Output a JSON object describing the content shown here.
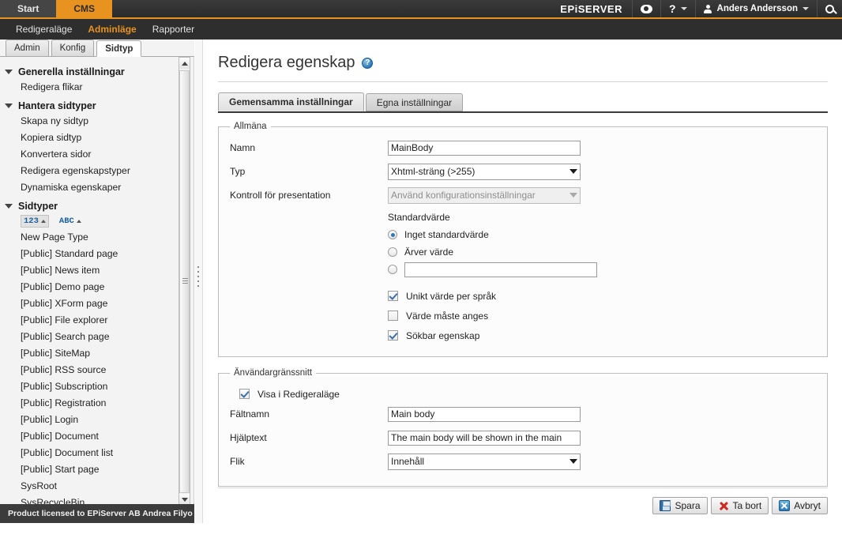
{
  "topbar": {
    "tabs": [
      {
        "label": "Start",
        "active": false
      },
      {
        "label": "CMS",
        "active": true
      }
    ],
    "brand": "EPiSERVER",
    "eye_icon": "eye-icon",
    "help_icon": "?",
    "user_name": "Anders Andersson",
    "search_icon": "search-icon",
    "accent_color": "#e8921f"
  },
  "navbar": {
    "items": [
      {
        "label": "Redigeraläge",
        "active": false
      },
      {
        "label": "Adminläge",
        "active": true
      },
      {
        "label": "Rapporter",
        "active": false
      }
    ]
  },
  "left_panel": {
    "subtabs": [
      {
        "label": "Admin",
        "active": false
      },
      {
        "label": "Konfig",
        "active": false
      },
      {
        "label": "Sidtyp",
        "active": true
      }
    ],
    "groups": [
      {
        "title": "Generella inställningar",
        "items": [
          "Redigera flikar"
        ]
      },
      {
        "title": "Hantera sidtyper",
        "items": [
          "Skapa ny sidtyp",
          "Kopiera sidtyp",
          "Konvertera sidor",
          "Redigera egenskapstyper",
          "Dynamiska egenskaper"
        ]
      },
      {
        "title": "Sidtyper",
        "items": [
          "New Page Type",
          "[Public] Standard page",
          "[Public] News item",
          "[Public] Demo page",
          "[Public] XForm page",
          "[Public] File explorer",
          "[Public] Search page",
          "[Public] SiteMap",
          "[Public] RSS source",
          "[Public] Subscription",
          "[Public] Registration",
          "[Public] Login",
          "[Public] Document",
          "[Public] Document list",
          "[Public] Start page",
          "SysRoot",
          "SysRecycleBin"
        ]
      }
    ],
    "sort_numeric_label": "123",
    "sort_alpha_label": "ABC",
    "license_text": "Product licensed to EPiServer AB Andrea Filyo"
  },
  "main": {
    "page_title": "Redigera egenskap",
    "help_icon_label": "?",
    "tabs": [
      {
        "label": "Gemensamma inställningar",
        "active": true
      },
      {
        "label": "Egna inställningar",
        "active": false
      }
    ],
    "general": {
      "legend": "Allmäna",
      "name_label": "Namn",
      "name_value": "MainBody",
      "type_label": "Typ",
      "type_value": "Xhtml-sträng (>255)",
      "presentation_label": "Kontroll för presentation",
      "presentation_value": "Använd konfigurationsinställningar",
      "default_value_label": "Standardvärde",
      "radios": [
        {
          "label": "Inget standardvärde",
          "selected": true
        },
        {
          "label": "Ärver värde",
          "selected": false
        },
        {
          "label": "",
          "selected": false
        }
      ],
      "custom_value": "",
      "checkboxes": [
        {
          "label": "Unikt värde per språk",
          "checked": true
        },
        {
          "label": "Värde måste anges",
          "checked": false
        },
        {
          "label": "Sökbar egenskap",
          "checked": true
        }
      ]
    },
    "ui_section": {
      "legend": "Änvändargränssnitt",
      "show_in_edit": {
        "label": "Visa i Redigeraläge",
        "checked": true
      },
      "fieldname_label": "Fältnamn",
      "fieldname_value": "Main body",
      "helptext_label": "Hjälptext",
      "helptext_value": "The main body will be shown in the main",
      "tab_label": "Flik",
      "tab_value": "Innehåll"
    },
    "actions": [
      {
        "label": "Spara",
        "icon": "save-icon"
      },
      {
        "label": "Ta bort",
        "icon": "delete-icon"
      },
      {
        "label": "Avbryt",
        "icon": "cancel-icon"
      }
    ]
  }
}
